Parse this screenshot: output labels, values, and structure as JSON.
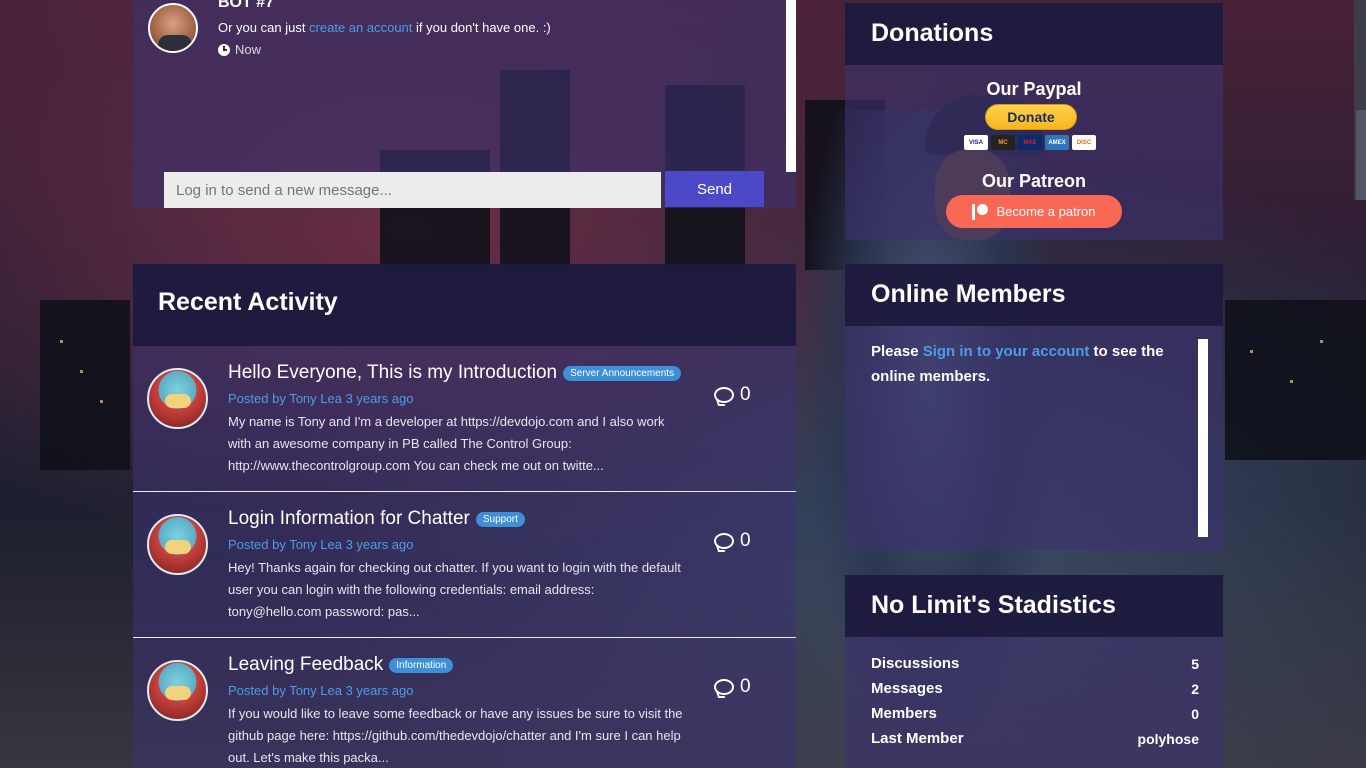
{
  "chat": {
    "bot_name": "BOT #7",
    "message_prefix": "Or you can just ",
    "message_link": "create an account",
    "message_suffix": " if you don't have one. :)",
    "time": "Now",
    "input_placeholder": "Log in to send a new message...",
    "send_label": "Send"
  },
  "activity": {
    "title": "Recent Activity",
    "items": [
      {
        "title": "Hello Everyone, This is my Introduction",
        "tag": "Server Announcements",
        "tag_color": "#3d8fd6",
        "posted": "Posted by Tony Lea 3 years ago",
        "excerpt": "My name is Tony and I'm a developer at https://devdojo.com and I also work with an awesome company in PB called The Control Group: http://www.thecontrolgroup.com You can check me out on twitte...",
        "comments": "0"
      },
      {
        "title": "Login Information for Chatter",
        "tag": "Support",
        "tag_color": "#3d8fd6",
        "posted": "Posted by Tony Lea 3 years ago",
        "excerpt": "Hey! Thanks again for checking out chatter. If you want to login with the default user you can login with the following credentials: email address: tony@hello.com password: pas...",
        "comments": "0"
      },
      {
        "title": "Leaving Feedback",
        "tag": "Information",
        "tag_color": "#3d8fd6",
        "posted": "Posted by Tony Lea 3 years ago",
        "excerpt": "If you would like to leave some feedback or have any issues be sure to visit the github page here: https://github.com/thedevdojo/chatter and I'm sure I can help out. Let's make this packa...",
        "comments": "0"
      }
    ]
  },
  "donations": {
    "title": "Donations",
    "paypal_title": "Our Paypal",
    "donate_label": "Donate",
    "cards": [
      "VISA",
      "MC",
      "MAE",
      "AMEX",
      "DISC"
    ],
    "patreon_title": "Our Patreon",
    "patron_label": "Become a patron",
    "patreon_color": "#f96854"
  },
  "online": {
    "title": "Online Members",
    "text_prefix": "Please ",
    "link": "Sign in to your account",
    "text_suffix": " to see the online members."
  },
  "stats": {
    "title": "No Limit's Stadistics",
    "rows": [
      {
        "label": "Discussions",
        "value": "5"
      },
      {
        "label": "Messages",
        "value": "2"
      },
      {
        "label": "Members",
        "value": "0"
      },
      {
        "label": "Last Member",
        "value": "polyhose"
      }
    ]
  }
}
